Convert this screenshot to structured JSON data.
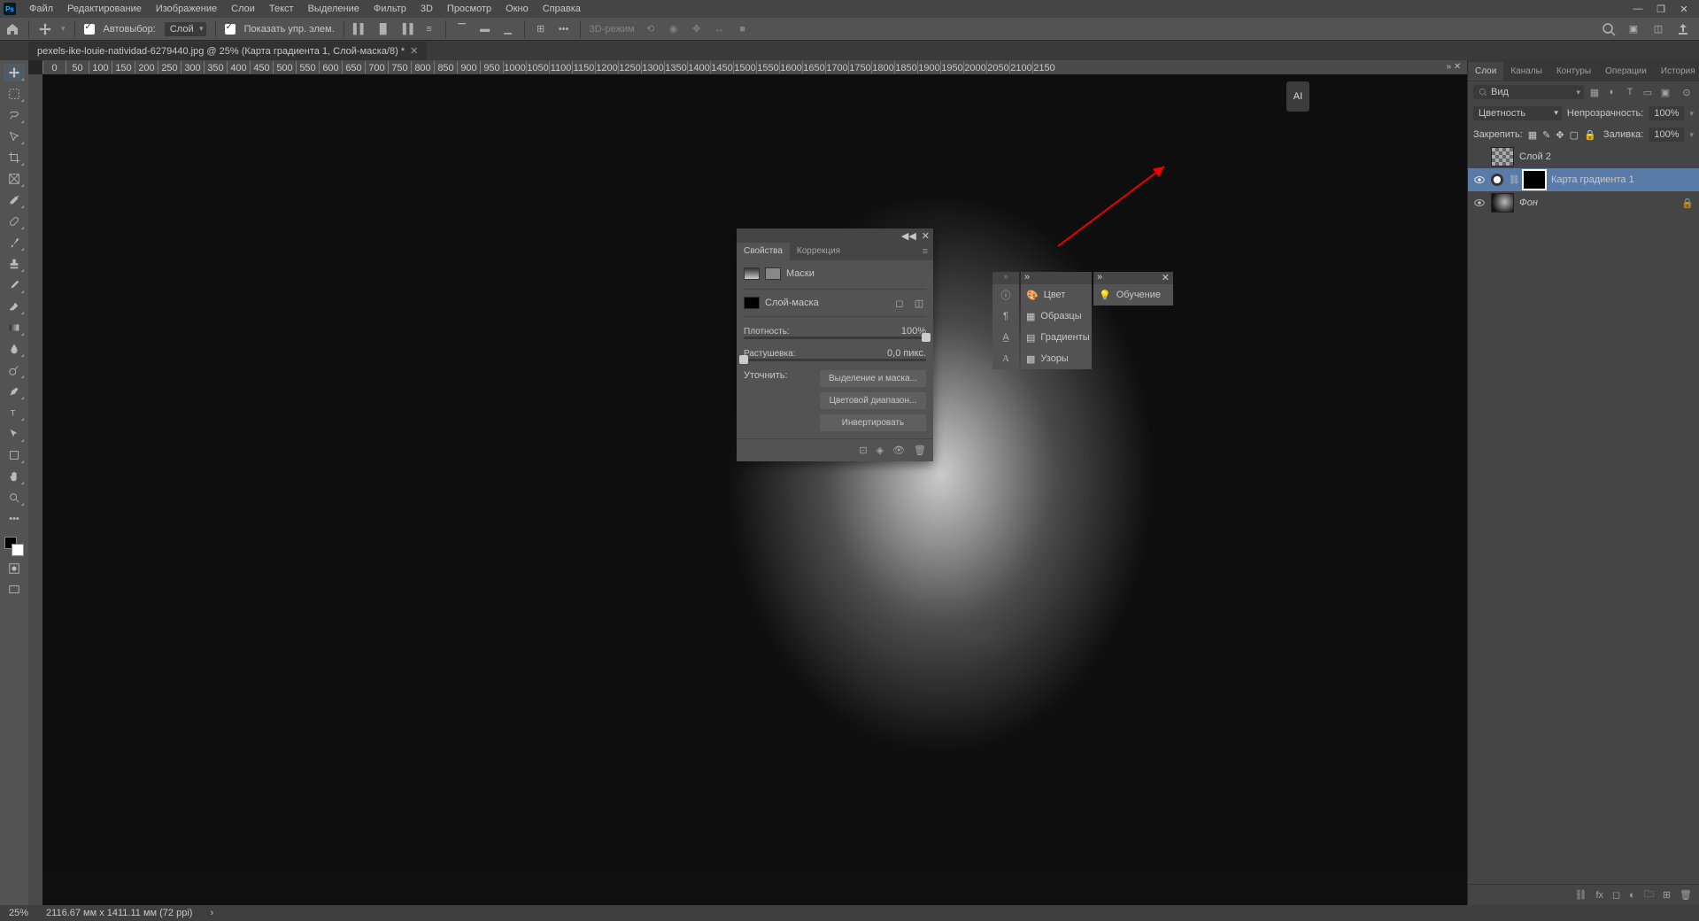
{
  "menu": {
    "items": [
      "Файл",
      "Редактирование",
      "Изображение",
      "Слои",
      "Текст",
      "Выделение",
      "Фильтр",
      "3D",
      "Просмотр",
      "Окно",
      "Справка"
    ]
  },
  "optbar": {
    "autoselect": "Автовыбор:",
    "autoselect_value": "Слой",
    "show_controls": "Показать упр. элем.",
    "d3_label": "3D-режим"
  },
  "tab": {
    "title": "pexels-ike-louie-natividad-6279440.jpg @ 25% (Карта градиента 1, Слой-маска/8) *"
  },
  "ruler": {
    "ticks": [
      "0",
      "50",
      "100",
      "150",
      "200",
      "250",
      "300",
      "350",
      "400",
      "450",
      "500",
      "550",
      "600",
      "650",
      "700",
      "750",
      "800",
      "850",
      "900",
      "950",
      "1000",
      "1050",
      "1100",
      "1150",
      "1200",
      "1250",
      "1300",
      "1350",
      "1400",
      "1450",
      "1500",
      "1550",
      "1600",
      "1650",
      "1700",
      "1750",
      "1800",
      "1850",
      "1900",
      "1950",
      "2000",
      "2050",
      "2100",
      "2150"
    ]
  },
  "ai_badge": "AI",
  "properties": {
    "panel_collapse": "◀◀",
    "panel_close": "✕",
    "tabs": [
      "Свойства",
      "Коррекция"
    ],
    "masks_label": "Маски",
    "layer_mask_label": "Слой-маска",
    "density_label": "Плотность:",
    "density_value": "100%",
    "feather_label": "Растушевка:",
    "feather_value": "0,0 пикс.",
    "refine_label": "Уточнить:",
    "btn_select_mask": "Выделение и маска...",
    "btn_color_range": "Цветовой диапазон...",
    "btn_invert": "Инвертировать"
  },
  "mini_panels": {
    "color": "Цвет",
    "swatches": "Образцы",
    "gradients": "Градиенты",
    "patterns": "Узоры",
    "learn": "Обучение"
  },
  "layers_panel": {
    "tabs": [
      "Слои",
      "Каналы",
      "Контуры",
      "Операции",
      "История"
    ],
    "search": "Вид",
    "blend_label": "Цветность",
    "opacity_label": "Непрозрачность:",
    "opacity_value": "100%",
    "lock_label": "Закрепить:",
    "fill_label": "Заливка:",
    "fill_value": "100%",
    "items": [
      {
        "name": "Слой 2",
        "visible": false,
        "type": "checker"
      },
      {
        "name": "Карта градиента 1",
        "visible": true,
        "type": "gradmap",
        "selected": true,
        "mask": "black"
      },
      {
        "name": "Фон",
        "visible": true,
        "type": "photo",
        "locked": true
      }
    ]
  },
  "status": {
    "zoom": "25%",
    "dims": "2116.67 мм x 1411.11 мм (72 ppi)"
  }
}
